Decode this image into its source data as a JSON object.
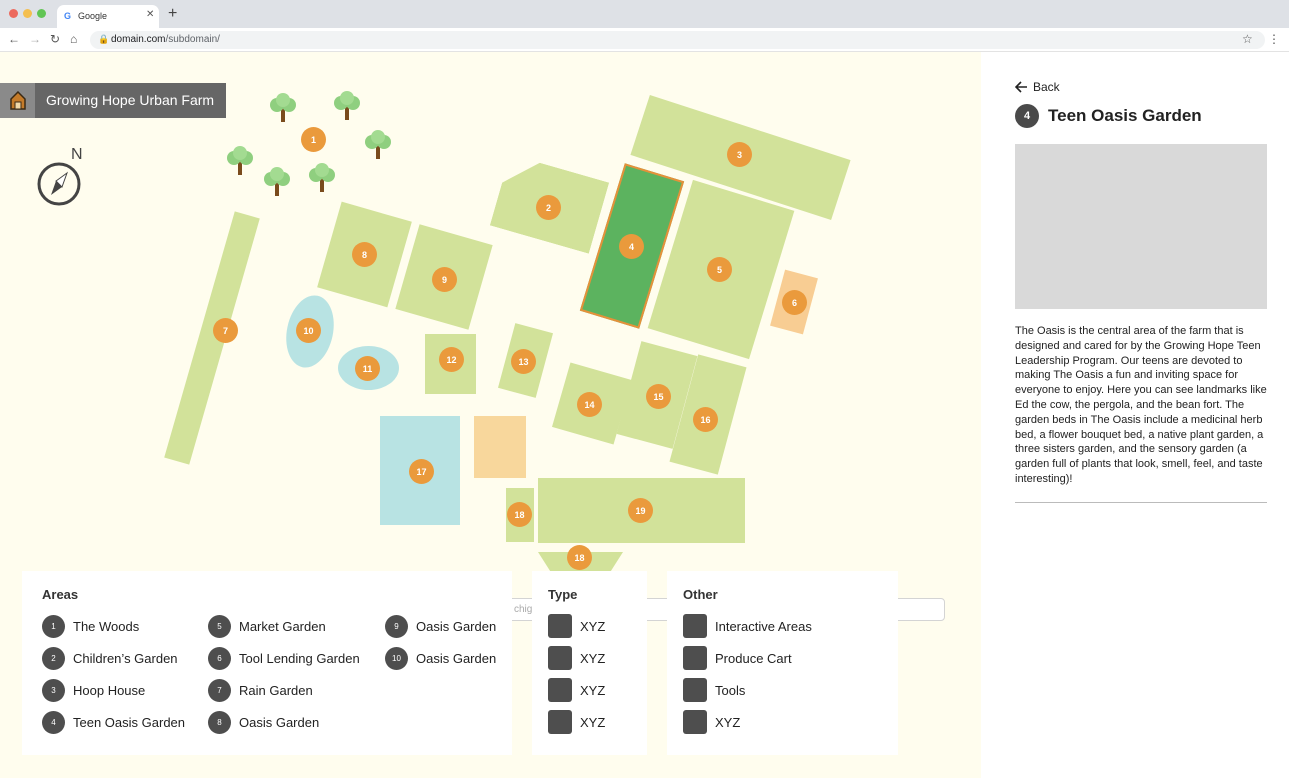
{
  "browser": {
    "tab_title": "Google",
    "url_domain": "domain.com",
    "url_path": "/subdomain/"
  },
  "header": {
    "title": "Growing Hope Urban Farm"
  },
  "compass": {
    "label": "N"
  },
  "search": {
    "partial_text": "chig"
  },
  "map": {
    "markers": [
      "1",
      "2",
      "3",
      "4",
      "5",
      "6",
      "7",
      "8",
      "9",
      "10",
      "11",
      "12",
      "13",
      "14",
      "15",
      "16",
      "17",
      "18",
      "18",
      "19"
    ]
  },
  "legend": {
    "areas_title": "Areas",
    "areas": [
      {
        "num": "1",
        "label": "The Woods"
      },
      {
        "num": "2",
        "label": "Children’s Garden"
      },
      {
        "num": "3",
        "label": "Hoop House"
      },
      {
        "num": "4",
        "label": "Teen Oasis Garden"
      },
      {
        "num": "5",
        "label": "Market Garden"
      },
      {
        "num": "6",
        "label": "Tool Lending Garden"
      },
      {
        "num": "7",
        "label": "Rain Garden"
      },
      {
        "num": "8",
        "label": "Oasis Garden"
      },
      {
        "num": "9",
        "label": "Oasis Garden"
      },
      {
        "num": "10",
        "label": "Oasis Garden"
      }
    ],
    "type_title": "Type",
    "types": [
      "XYZ",
      "XYZ",
      "XYZ",
      "XYZ"
    ],
    "other_title": "Other",
    "other": [
      "Interactive Areas",
      "Produce Cart",
      "Tools",
      "XYZ"
    ]
  },
  "detail": {
    "back_label": "Back",
    "num": "4",
    "title": "Teen Oasis Garden",
    "description": "The Oasis is the central area of the farm that is designed and cared for by the Growing Hope Teen Leadership Program. Our teens are devoted to making The Oasis a fun and inviting space for everyone to enjoy. Here you can see landmarks like Ed the cow, the pergola, and the bean fort. The garden beds in The Oasis include a medicinal herb bed, a flower bouquet bed, a native plant garden, a three sisters garden, and the sensory garden (a garden full of plants that look, smell, feel, and taste interesting)!"
  },
  "colors": {
    "map_background": "#fffdee",
    "plot_green": "#d2e29a",
    "selected_plot": "#5cb35f",
    "water_blue": "#b8e3e3",
    "sand_orange": "#f8d79c",
    "marker_orange": "#ea9a3c",
    "legend_badge": "#4e4e4e"
  },
  "icons": {
    "back": "arrow-left-icon",
    "compass": "compass-icon",
    "tree": "tree-icon",
    "logo": "farm-logo-icon"
  }
}
